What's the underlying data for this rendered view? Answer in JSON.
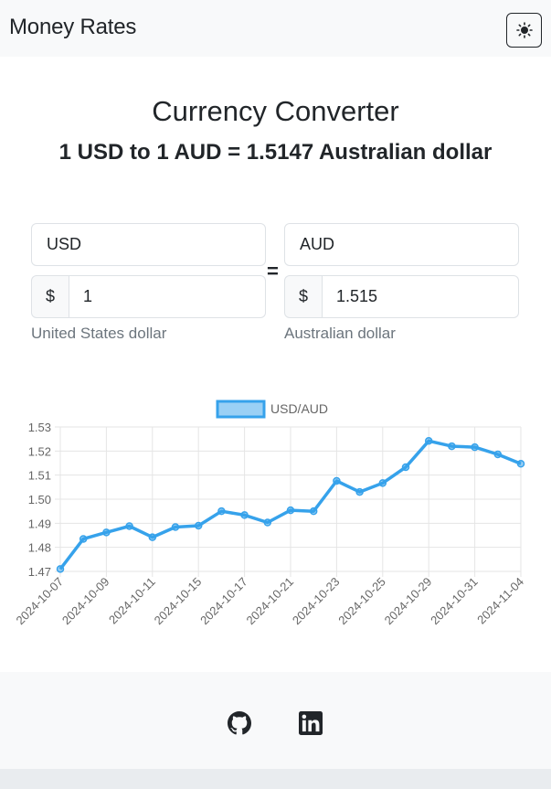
{
  "navbar": {
    "brand": "Money Rates",
    "theme_toggle_icon": "sun-icon"
  },
  "converter": {
    "title": "Currency Converter",
    "summary": "1 USD to 1 AUD = 1.5147 Australian dollar",
    "from": {
      "code": "USD",
      "symbol": "$",
      "amount": "1",
      "name": "United States dollar"
    },
    "equals": "=",
    "to": {
      "code": "AUD",
      "symbol": "$",
      "amount": "1.515",
      "name": "Australian dollar"
    }
  },
  "chart_data": {
    "type": "line",
    "series": [
      {
        "name": "USD/AUD",
        "color": "#36a2eb",
        "x": [
          "2024-10-07",
          "2024-10-08",
          "2024-10-09",
          "2024-10-10",
          "2024-10-11",
          "2024-10-14",
          "2024-10-15",
          "2024-10-16",
          "2024-10-17",
          "2024-10-18",
          "2024-10-21",
          "2024-10-22",
          "2024-10-23",
          "2024-10-24",
          "2024-10-25",
          "2024-10-28",
          "2024-10-29",
          "2024-10-30",
          "2024-10-31",
          "2024-11-01",
          "2024-11-04"
        ],
        "values": [
          1.471,
          1.4835,
          1.4862,
          1.4888,
          1.4842,
          1.4884,
          1.489,
          1.495,
          1.4934,
          1.4903,
          1.4954,
          1.495,
          1.5076,
          1.503,
          1.5067,
          1.5133,
          1.5242,
          1.522,
          1.5216,
          1.5186,
          1.5147
        ]
      }
    ],
    "x_tick_labels": [
      "2024-10-07",
      "2024-10-09",
      "2024-10-11",
      "2024-10-15",
      "2024-10-17",
      "2024-10-21",
      "2024-10-23",
      "2024-10-25",
      "2024-10-29",
      "2024-10-31",
      "2024-11-04"
    ],
    "y_tick_labels": [
      "1.53",
      "1.52",
      "1.51",
      "1.50",
      "1.49",
      "1.48",
      "1.47"
    ],
    "ylim": [
      1.47,
      1.53
    ],
    "grid": true,
    "legend": "top"
  },
  "footer": {
    "icons": [
      "github-icon",
      "linkedin-icon"
    ]
  }
}
